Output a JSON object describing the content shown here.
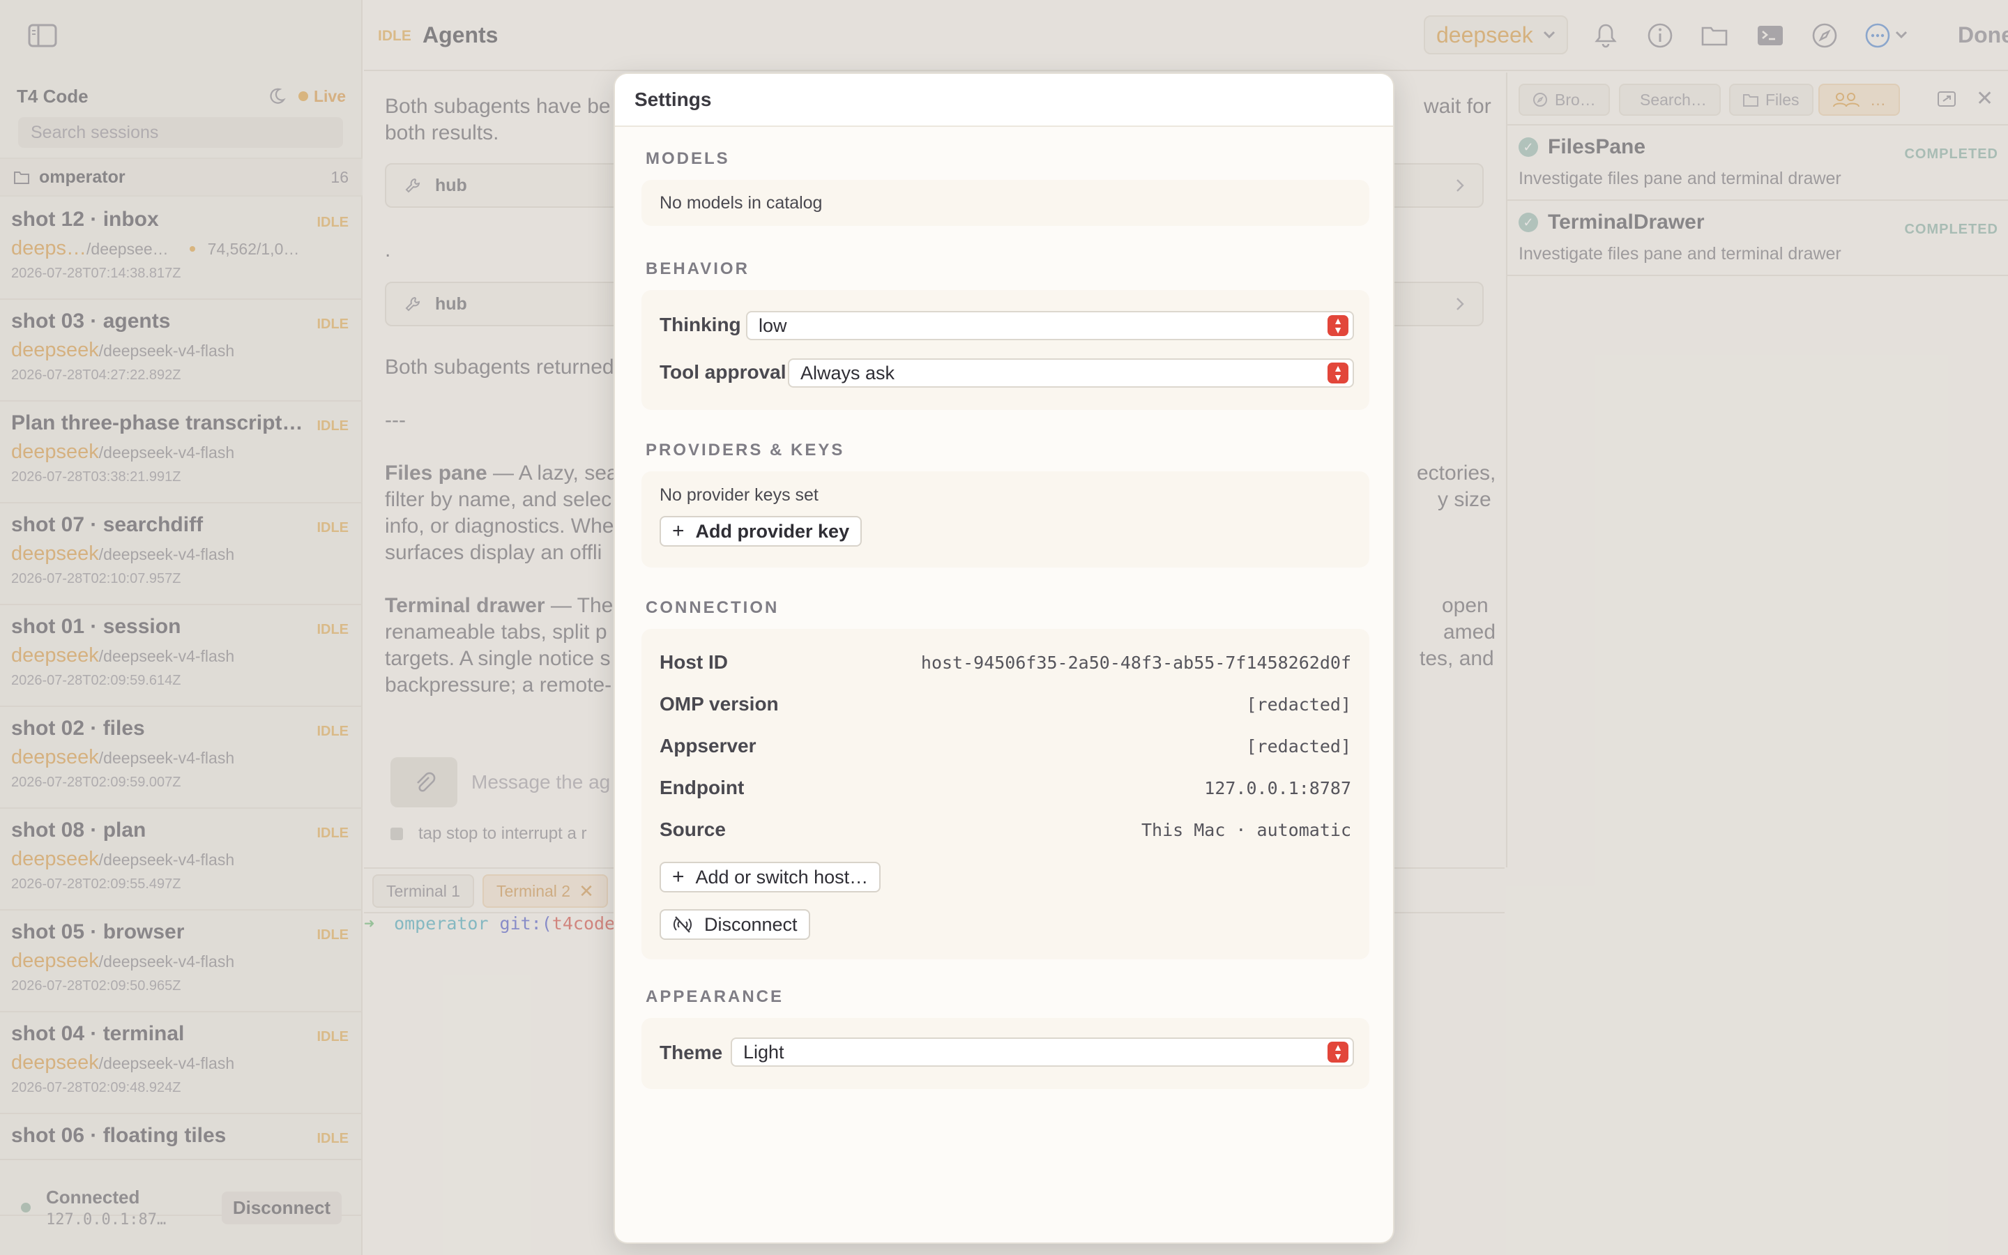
{
  "app": {
    "sidebar_title": "T4 Code",
    "live_label": "Live",
    "search_placeholder": "Search sessions",
    "group_name": "omperator",
    "group_count": "16"
  },
  "sessions": [
    {
      "title": "shot 12 · inbox",
      "status": "IDLE",
      "provider": "deeps…",
      "model": "/deepsee…",
      "tokens": "74,562/1,0…",
      "time": "2026-07-28T07:14:38.817Z"
    },
    {
      "title": "shot 03 · agents",
      "status": "IDLE",
      "provider": "deepseek",
      "model": "/deepseek-v4-flash",
      "tokens": "",
      "time": "2026-07-28T04:27:22.892Z"
    },
    {
      "title": "Plan three-phase transcript…",
      "status": "IDLE",
      "provider": "deepseek",
      "model": "/deepseek-v4-flash",
      "tokens": "",
      "time": "2026-07-28T03:38:21.991Z"
    },
    {
      "title": "shot 07 · searchdiff",
      "status": "IDLE",
      "provider": "deepseek",
      "model": "/deepseek-v4-flash",
      "tokens": "",
      "time": "2026-07-28T02:10:07.957Z"
    },
    {
      "title": "shot 01 · session",
      "status": "IDLE",
      "provider": "deepseek",
      "model": "/deepseek-v4-flash",
      "tokens": "",
      "time": "2026-07-28T02:09:59.614Z"
    },
    {
      "title": "shot 02 · files",
      "status": "IDLE",
      "provider": "deepseek",
      "model": "/deepseek-v4-flash",
      "tokens": "",
      "time": "2026-07-28T02:09:59.007Z"
    },
    {
      "title": "shot 08 · plan",
      "status": "IDLE",
      "provider": "deepseek",
      "model": "/deepseek-v4-flash",
      "tokens": "",
      "time": "2026-07-28T02:09:55.497Z"
    },
    {
      "title": "shot 05 · browser",
      "status": "IDLE",
      "provider": "deepseek",
      "model": "/deepseek-v4-flash",
      "tokens": "",
      "time": "2026-07-28T02:09:50.965Z"
    },
    {
      "title": "shot 04 · terminal",
      "status": "IDLE",
      "provider": "deepseek",
      "model": "/deepseek-v4-flash",
      "tokens": "",
      "time": "2026-07-28T02:09:48.924Z"
    },
    {
      "title": "shot 06 · floating tiles",
      "status": "IDLE",
      "provider": "",
      "model": "",
      "tokens": "",
      "time": ""
    }
  ],
  "connection": {
    "label": "Connected",
    "host": "127.0.0.1:87…",
    "disconnect": "Disconnect"
  },
  "header": {
    "status": "IDLE",
    "title": "Agents",
    "model": "deepseek",
    "done": "Done"
  },
  "chat": {
    "line1a": "Both subagents have be",
    "line1b": "wait for",
    "line2": "both results.",
    "tool1": "hub",
    "dot": ".",
    "tool2": "hub",
    "line3": "Both subagents returned",
    "sep": "---",
    "files_bold": "Files pane",
    "files_text": " — A lazy, sea",
    "files_l2": "filter by name, and selec",
    "files_l3": "info, or diagnostics. Whe",
    "files_l4": "surfaces display an offli",
    "files_r1": "ectories,",
    "files_r2": "y size",
    "term_bold": "Terminal drawer",
    "term_text": " — The",
    "term_l2": "renameable tabs, split p",
    "term_l3": "targets. A single notice s",
    "term_l4": "backpressure; a remote-",
    "term_r1": "open",
    "term_r2": "amed",
    "term_r3": "tes, and",
    "placeholder": "Message the ag",
    "hint": "tap stop to interrupt a r"
  },
  "terminal": {
    "tabs": [
      "Terminal 1",
      "Terminal 2"
    ],
    "prompt_arrow": "➜",
    "prompt_dir": "omperator",
    "prompt_git": "git:(",
    "prompt_branch": "t4code"
  },
  "right_pane": {
    "tabs": [
      "Bro…",
      "Search…",
      "Files",
      "…"
    ],
    "agents": [
      {
        "name": "FilesPane",
        "status": "COMPLETED",
        "desc": "Investigate files pane and terminal drawer"
      },
      {
        "name": "TerminalDrawer",
        "status": "COMPLETED",
        "desc": "Investigate files pane and terminal drawer"
      }
    ]
  },
  "settings": {
    "title": "Settings",
    "models_label": "MODELS",
    "models_empty": "No models in catalog",
    "behavior_label": "BEHAVIOR",
    "thinking_label": "Thinking",
    "thinking_value": "low",
    "tool_approval_label": "Tool approval",
    "tool_approval_value": "Always ask",
    "providers_label": "PROVIDERS & KEYS",
    "providers_empty": "No provider keys set",
    "add_key": "Add provider key",
    "connection_label": "CONNECTION",
    "host_id_label": "Host ID",
    "host_id_value": "host-94506f35-2a50-48f3-ab55-7f1458262d0f",
    "omp_label": "OMP version",
    "omp_value": "[redacted]",
    "appserver_label": "Appserver",
    "appserver_value": "[redacted]",
    "endpoint_label": "Endpoint",
    "endpoint_value": "127.0.0.1:8787",
    "source_label": "Source",
    "source_value": "This Mac · automatic",
    "add_host": "Add or switch host…",
    "disconnect": "Disconnect",
    "appearance_label": "APPEARANCE",
    "theme_label": "Theme",
    "theme_value": "Light"
  },
  "colors": {
    "accent": "#e0a24a",
    "stepper": "#e2463a",
    "completed": "#8fb6ac"
  }
}
